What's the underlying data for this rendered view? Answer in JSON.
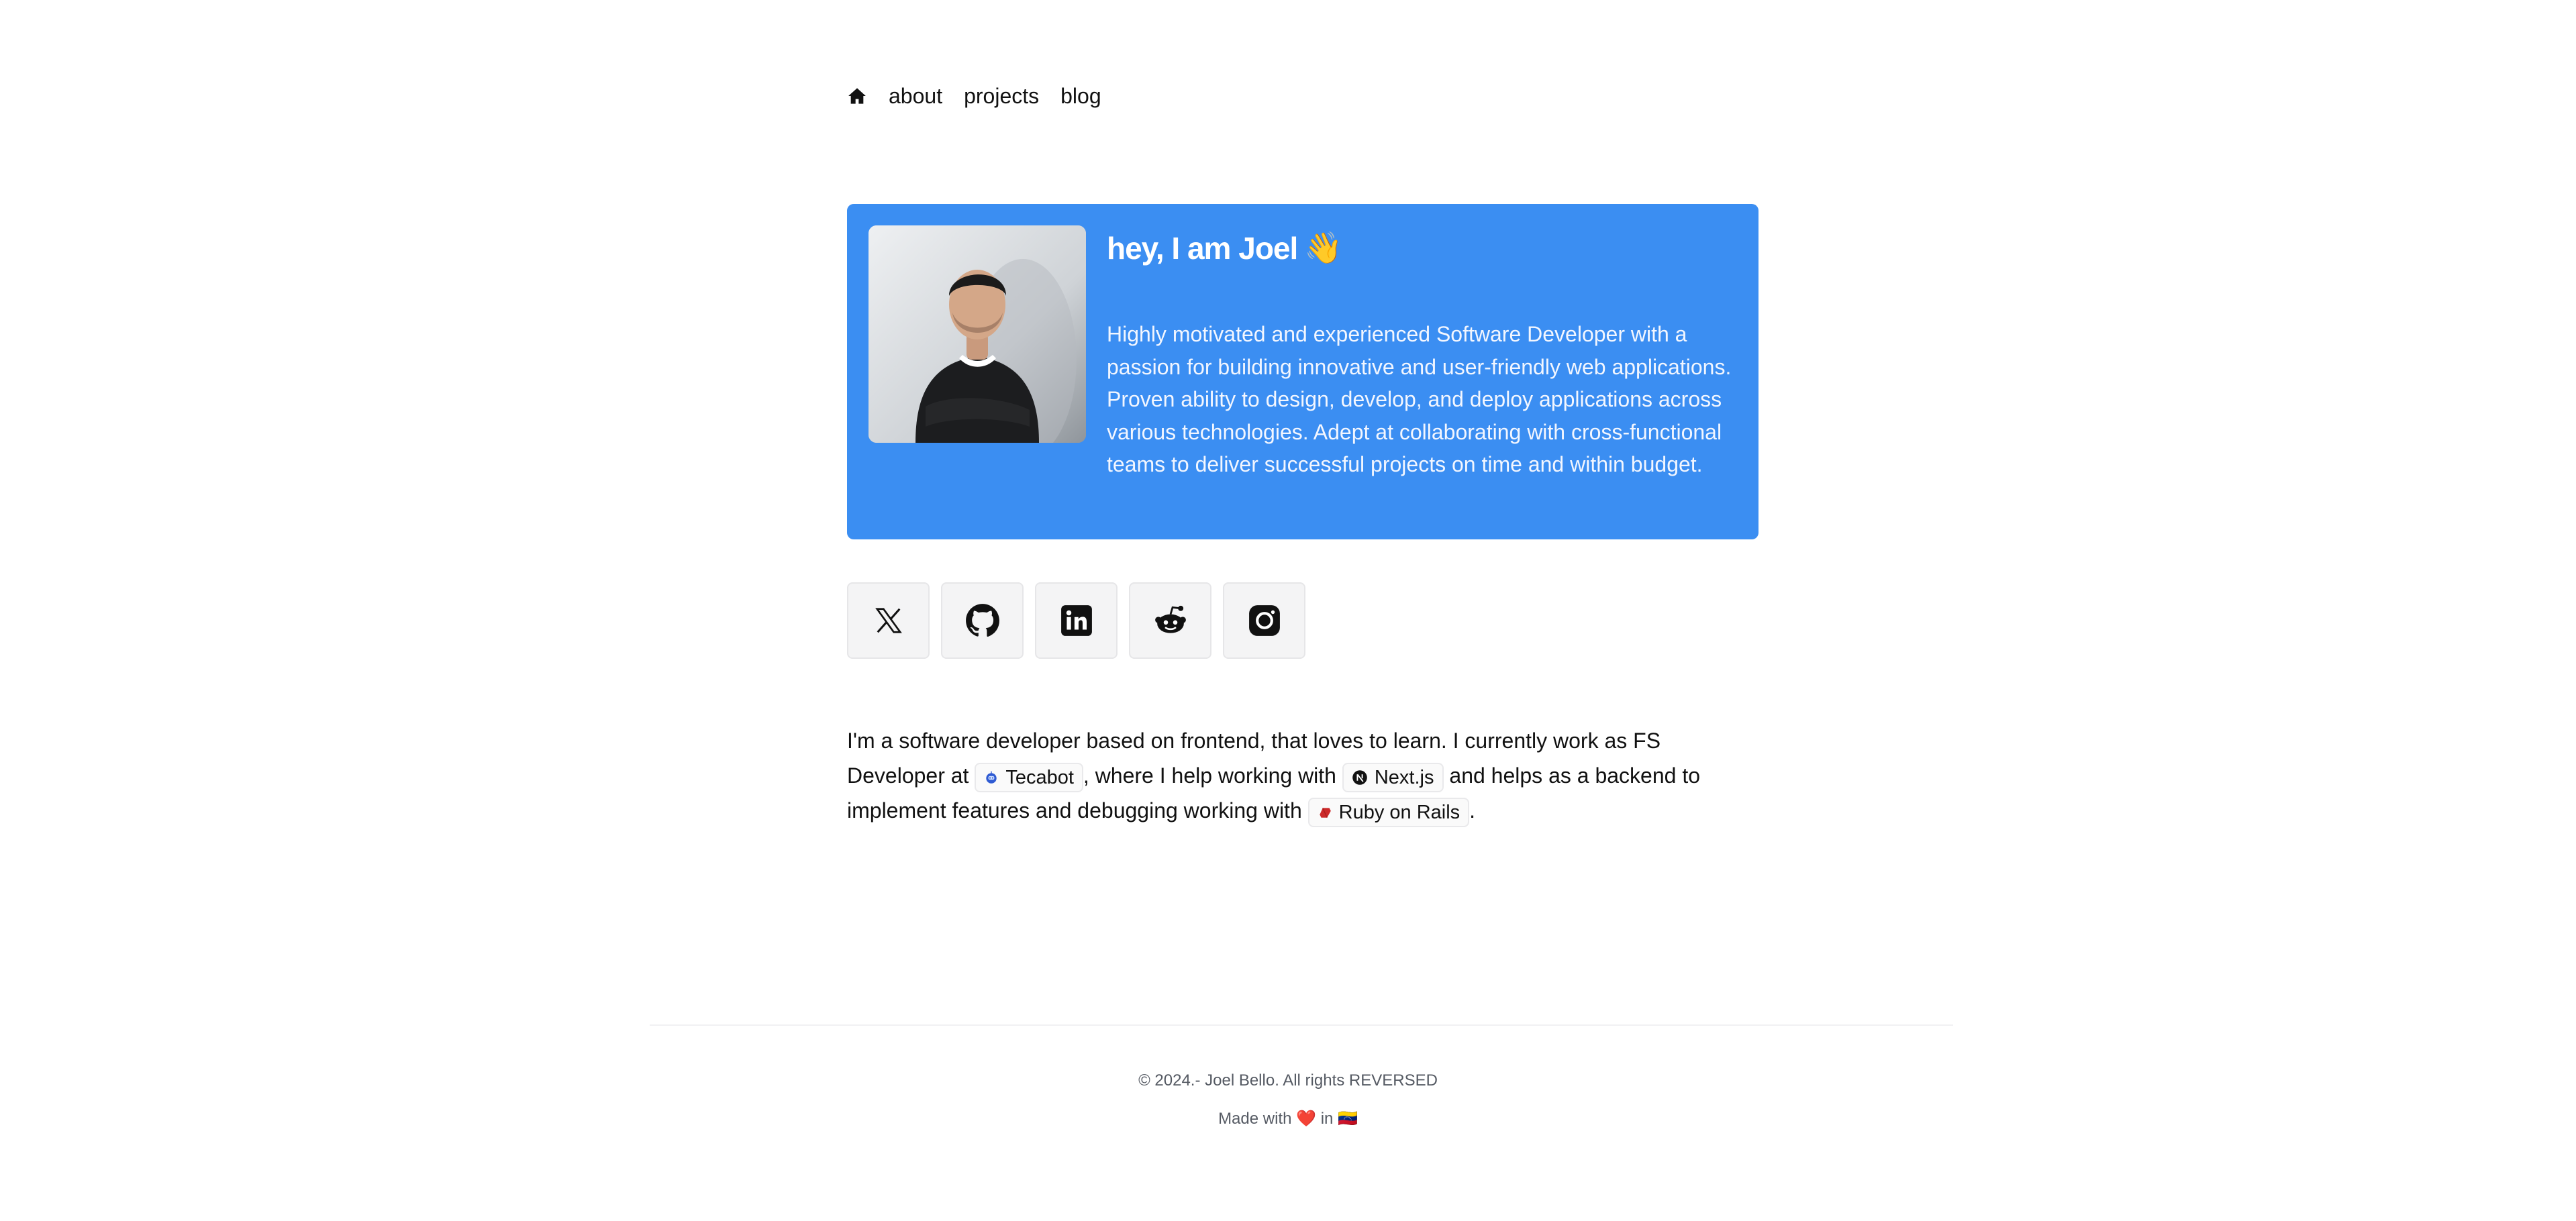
{
  "nav": {
    "home_icon": "home-icon",
    "items": [
      "about",
      "projects",
      "blog"
    ]
  },
  "hero": {
    "title": "hey, I am Joel",
    "wave_emoji": "👋",
    "bio": "Highly motivated and experienced Software Developer with a passion for building innovative and user-friendly web applications. Proven ability to design, develop, and deploy applications across various technologies. Adept at collaborating with cross-functional teams to deliver successful projects on time and within budget.",
    "card_color": "#3b8ef2"
  },
  "social": [
    {
      "icon": "x-twitter-icon"
    },
    {
      "icon": "github-icon"
    },
    {
      "icon": "linkedin-icon"
    },
    {
      "icon": "reddit-icon"
    },
    {
      "icon": "instagram-icon"
    }
  ],
  "intro": {
    "part1": "I'm a software developer based on frontend, that loves to learn. I currently work as FS Developer at ",
    "company": "Tecabot",
    "part2": ", where I help working with ",
    "tech1": "Next.js",
    "part3": " and helps as a backend to implement features and debugging working with ",
    "tech2": "Ruby on Rails",
    "part4": "."
  },
  "footer": {
    "copyright": "© 2024.- Joel Bello. All rights REVERSED",
    "made_with_prefix": "Made with",
    "heart": "❤️",
    "made_with_in": "in",
    "flag": "🇻🇪"
  }
}
